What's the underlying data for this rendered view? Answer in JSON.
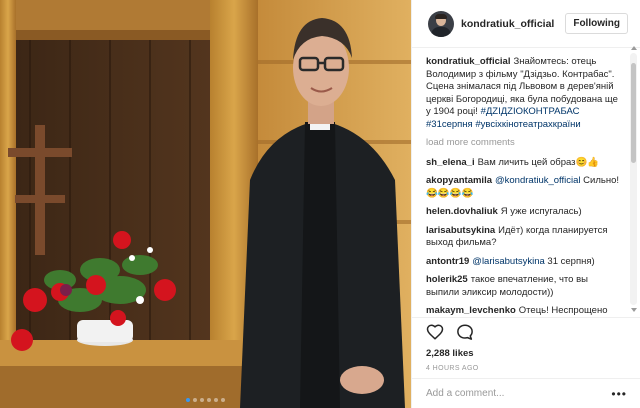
{
  "post": {
    "username": "kondratiuk_official",
    "follow_label": "Following",
    "caption": {
      "username": "kondratiuk_official",
      "text": "Знайомтесь: отець Володимир з фільму \"Дзідзьо. Контрабас\". Сцена знімалася під Львовом в дерев'яній церкві Богородиці, яка була побудована ще у 1904 році!",
      "hashtags": "#ДZIДZIOКОНТРАБАС #31серпня #увсіхкінотеатрахкраїни"
    },
    "load_more": "load more comments",
    "comments": [
      {
        "user": "sh_elena_i",
        "text": "Вам личить цей образ😊👍"
      },
      {
        "user": "akopyantamila",
        "mention": "@kondratiuk_official",
        "text": "Сильно! 😂😂😂😂"
      },
      {
        "user": "helen.dovhaliuk",
        "text": "Я уже испугалась)"
      },
      {
        "user": "larisabutsykina",
        "text": "Идёт) когда планируется выход фильма?"
      },
      {
        "user": "antontr19",
        "mention": "@larisabutsykina",
        "text": "31 серпня)"
      },
      {
        "user": "holerik25",
        "text": "такое впечатление, что вы выпили эликсир молодости))"
      },
      {
        "user": "makaym_levchenko",
        "text": "Отець! Неспрощено"
      }
    ],
    "likes": "2,288 likes",
    "time": "4 HOURS AGO",
    "comment_placeholder": "Add a comment...",
    "more_icon": "•••"
  },
  "carousel": {
    "count": 6,
    "active_index": 0
  },
  "icons": {
    "like": "heart-icon",
    "comment": "comment-bubble-icon",
    "more": "ellipsis-icon"
  },
  "colors": {
    "link": "#003569",
    "active_dot": "#3897f0",
    "muted": "#999999"
  }
}
